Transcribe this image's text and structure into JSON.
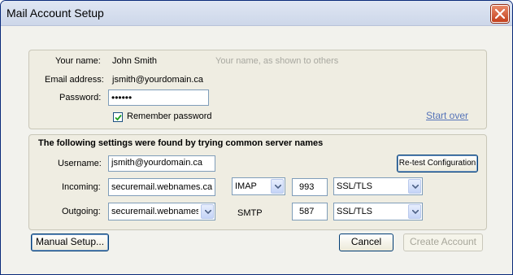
{
  "window": {
    "title": "Mail Account Setup"
  },
  "account": {
    "name_label": "Your name:",
    "name_value": "John Smith",
    "name_hint": "Your name, as shown to others",
    "email_label": "Email address:",
    "email_value": "jsmith@yourdomain.ca",
    "password_label": "Password:",
    "password_value": "••••••",
    "remember_label": "Remember password",
    "remember_checked": true,
    "start_over": "Start over"
  },
  "settings": {
    "heading": "The following settings were found by trying common server names",
    "username_label": "Username:",
    "username_value": "jsmith@yourdomain.ca",
    "retest_button": "Re-test Configuration",
    "incoming_label": "Incoming:",
    "incoming_server": "securemail.webnames.ca",
    "incoming_protocol": "IMAP",
    "incoming_port": "993",
    "incoming_security": "SSL/TLS",
    "outgoing_label": "Outgoing:",
    "outgoing_server": "securemail.webnames.ca",
    "outgoing_protocol": "SMTP",
    "outgoing_port": "587",
    "outgoing_security": "SSL/TLS"
  },
  "buttons": {
    "manual_setup": "Manual Setup...",
    "cancel": "Cancel",
    "create_account": "Create Account"
  },
  "icons": {
    "close": "close-icon",
    "dropdown": "chevron-down-icon",
    "checkmark": "checkmark-icon"
  }
}
